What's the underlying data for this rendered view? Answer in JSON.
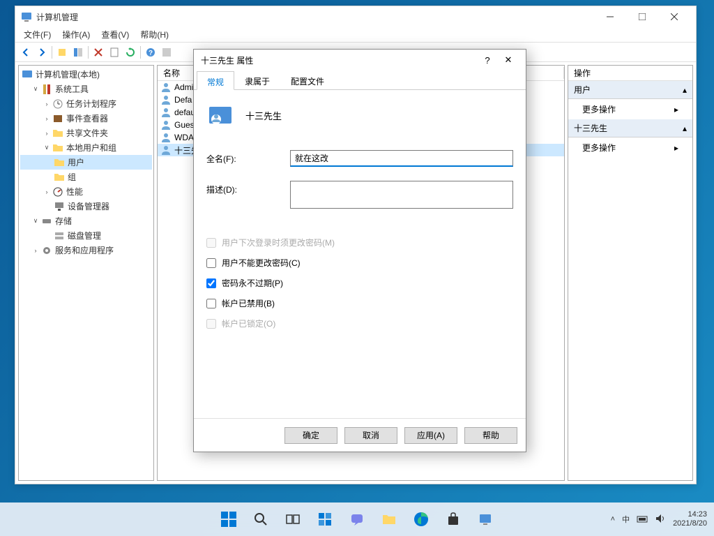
{
  "window": {
    "title": "计算机管理"
  },
  "menubar": {
    "file": "文件(F)",
    "action": "操作(A)",
    "view": "查看(V)",
    "help": "帮助(H)"
  },
  "tree": {
    "root": "计算机管理(本地)",
    "system_tools": "系统工具",
    "task_scheduler": "任务计划程序",
    "event_viewer": "事件查看器",
    "shared_folders": "共享文件夹",
    "local_users_groups": "本地用户和组",
    "users": "用户",
    "groups": "组",
    "performance": "性能",
    "device_manager": "设备管理器",
    "storage": "存储",
    "disk_management": "磁盘管理",
    "services": "服务和应用程序"
  },
  "list": {
    "header_name": "名称",
    "rows": [
      "Admi",
      "Defa",
      "defau",
      "Gues",
      "WDA",
      "十三先"
    ]
  },
  "actions": {
    "header": "操作",
    "section1": "用户",
    "more_actions": "更多操作",
    "section2": "十三先生"
  },
  "dialog": {
    "title": "十三先生 属性",
    "tabs": {
      "general": "常规",
      "member_of": "隶属于",
      "profile": "配置文件"
    },
    "display_name": "十三先生",
    "fullname_label": "全名(F):",
    "fullname_value": "就在这改",
    "description_label": "描述(D):",
    "description_value": "",
    "cb_must_change": "用户下次登录时须更改密码(M)",
    "cb_cannot_change": "用户不能更改密码(C)",
    "cb_never_expires": "密码永不过期(P)",
    "cb_disabled": "帐户已禁用(B)",
    "cb_locked": "帐户已锁定(O)",
    "btn_ok": "确定",
    "btn_cancel": "取消",
    "btn_apply": "应用(A)",
    "btn_help": "帮助"
  },
  "taskbar": {
    "time": "14:23",
    "date": "2021/8/20",
    "ime": "中"
  }
}
